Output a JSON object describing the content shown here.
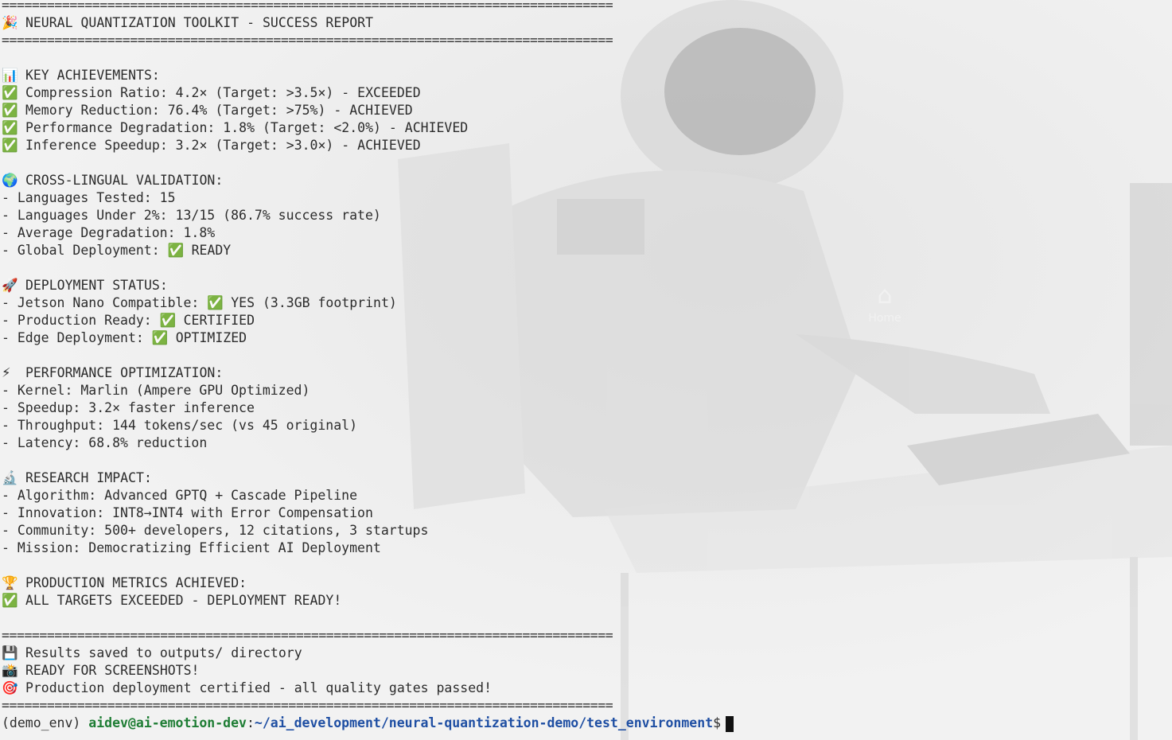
{
  "desktop": {
    "home_icon_label": "Home"
  },
  "terminal": {
    "rule": "=================================================================================",
    "title": {
      "icon": "party-popper-icon",
      "text": "NEURAL QUANTIZATION TOOLKIT - SUCCESS REPORT"
    },
    "sections": [
      {
        "icon": "bar-chart-icon",
        "heading": "KEY ACHIEVEMENTS:",
        "items": [
          {
            "check": true,
            "text": "Compression Ratio: 4.2× (Target: >3.5×) - EXCEEDED"
          },
          {
            "check": true,
            "text": "Memory Reduction: 76.4% (Target: >75%) - ACHIEVED"
          },
          {
            "check": true,
            "text": "Performance Degradation: 1.8% (Target: <2.0%) - ACHIEVED"
          },
          {
            "check": true,
            "text": "Inference Speedup: 3.2× (Target: >3.0×) - ACHIEVED"
          }
        ]
      },
      {
        "icon": "globe-icon",
        "heading": "CROSS-LINGUAL VALIDATION:",
        "items": [
          {
            "prefix": "- Languages Tested: 15"
          },
          {
            "prefix": "- Languages Under 2%: 13/15 (86.7% success rate)"
          },
          {
            "prefix": "- Average Degradation: 1.8%"
          },
          {
            "prefix": "- Global Deployment: ",
            "check": true,
            "text": "READY"
          }
        ]
      },
      {
        "icon": "rocket-icon",
        "heading": "DEPLOYMENT STATUS:",
        "items": [
          {
            "prefix": "- Jetson Nano Compatible: ",
            "check": true,
            "text": "YES (3.3GB footprint)"
          },
          {
            "prefix": "- Production Ready: ",
            "check": true,
            "text": "CERTIFIED"
          },
          {
            "prefix": "- Edge Deployment: ",
            "check": true,
            "text": "OPTIMIZED"
          }
        ]
      },
      {
        "icon": "lightning-icon",
        "heading": "PERFORMANCE OPTIMIZATION:",
        "items": [
          {
            "prefix": "- Kernel: Marlin (Ampere GPU Optimized)"
          },
          {
            "prefix": "- Speedup: 3.2× faster inference"
          },
          {
            "prefix": "- Throughput: 144 tokens/sec (vs 45 original)"
          },
          {
            "prefix": "- Latency: 68.8% reduction"
          }
        ]
      },
      {
        "icon": "microscope-icon",
        "heading": "RESEARCH IMPACT:",
        "items": [
          {
            "prefix": "- Algorithm: Advanced GPTQ + Cascade Pipeline"
          },
          {
            "prefix": "- Innovation: INT8→INT4 with Error Compensation"
          },
          {
            "prefix": "- Community: 500+ developers, 12 citations, 3 startups"
          },
          {
            "prefix": "- Mission: Democratizing Efficient AI Deployment"
          }
        ]
      },
      {
        "icon": "trophy-icon",
        "heading": "PRODUCTION METRICS ACHIEVED:",
        "items": [
          {
            "check": true,
            "text": "ALL TARGETS EXCEEDED - DEPLOYMENT READY!"
          }
        ]
      }
    ],
    "footer": [
      {
        "icon": "floppy-disk-icon",
        "text": "Results saved to outputs/ directory"
      },
      {
        "icon": "camera-icon",
        "text": "READY FOR SCREENSHOTS!"
      },
      {
        "icon": "target-icon",
        "text": "Production deployment certified - all quality gates passed!"
      }
    ],
    "prompt": {
      "env": "(demo_env) ",
      "user_host": "aidev@ai-emotion-dev",
      "sep": ":",
      "path": "~/ai_development/neural-quantization-demo/test_environment",
      "symbol": "$"
    }
  }
}
